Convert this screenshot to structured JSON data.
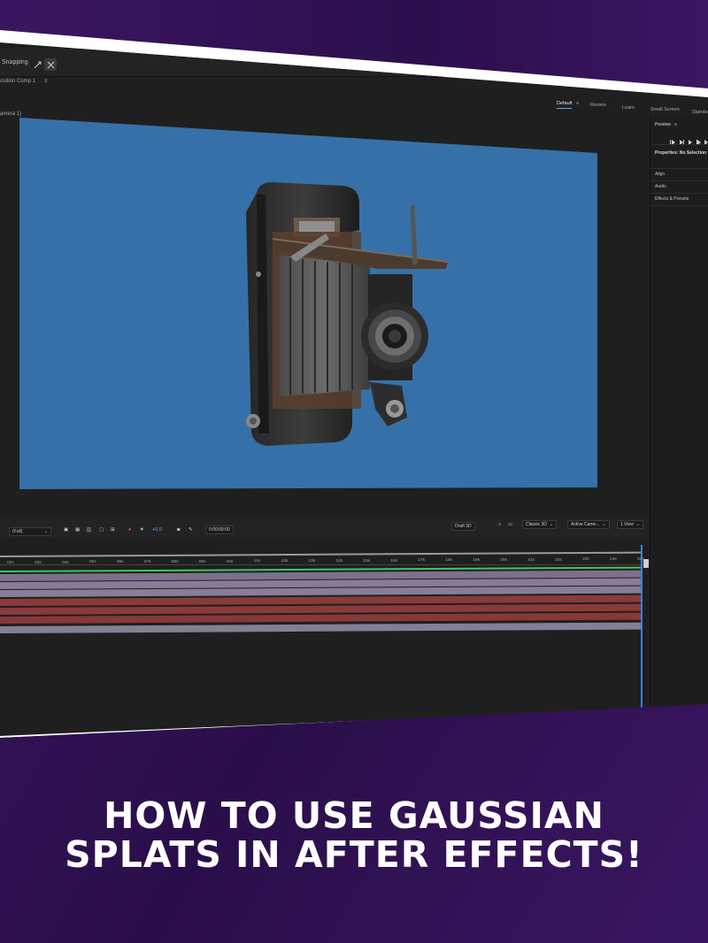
{
  "toolbar": {
    "snapping_label": "Snapping",
    "comp_tab_label": "osition Comp 1",
    "comp_tab_menu": "≡",
    "viewer_label": "amera 1)"
  },
  "workspaces": {
    "default": "Default",
    "default_menu": "≡",
    "review": "Review",
    "learn": "Learn",
    "small_screen": "Small Screen",
    "standard": "Standa"
  },
  "right_panel": {
    "preview": "Preview",
    "preview_menu": "≡",
    "properties": "Properties: No Selection",
    "align": "Align",
    "audio": "Audio",
    "effects": "Effects & Presets"
  },
  "viewer_bar": {
    "resolution": "(Full)",
    "exposure": "+0.0",
    "timecode": "0:00:00:00",
    "draft3d": "Draft 3D",
    "renderer": "Classic 3D",
    "camera": "Active Came...",
    "views": "1 View"
  },
  "timeline": {
    "ruler": [
      "02s",
      "03s",
      "04s",
      "05s",
      "06s",
      "07s",
      "08s",
      "09s",
      "10s",
      "11s",
      "12s",
      "13s",
      "14s",
      "15s",
      "16s",
      "17s",
      "18s",
      "19s",
      "20s",
      "21s",
      "22s",
      "23s",
      "24s",
      "25s"
    ]
  },
  "colors": {
    "viewer_bg": "#3571a8",
    "accent": "#58a7ff",
    "track_lilac": "#8b7a98",
    "track_red": "#8a3a3a",
    "track_gray": "#857f93",
    "track_green": "#3fc85a"
  },
  "headline": {
    "line1": "HOW TO USE GAUSSIAN",
    "line2": "SPLATS IN AFTER EFFECTS!"
  }
}
